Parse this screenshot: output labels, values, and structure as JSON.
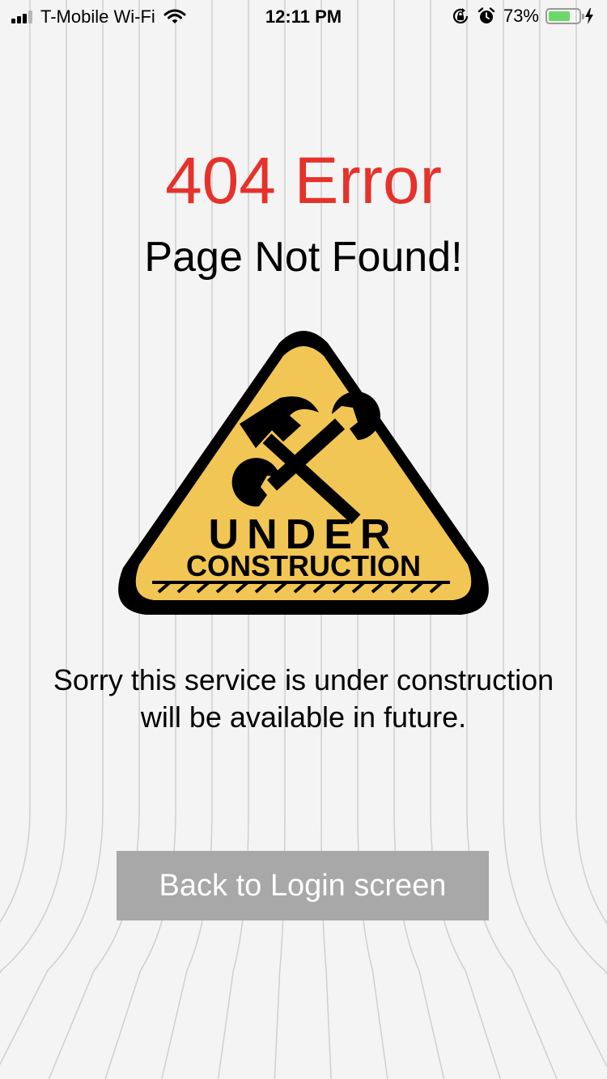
{
  "status_bar": {
    "carrier": "T-Mobile Wi-Fi",
    "time": "12:11 PM",
    "battery_percent_label": "73%",
    "battery_level": 0.73,
    "signal_bars_filled": 3,
    "signal_bars_total": 4,
    "icons": [
      "signal-icon",
      "wifi-icon",
      "orientation-lock-icon",
      "alarm-icon",
      "battery-icon",
      "charging-bolt-icon"
    ]
  },
  "error": {
    "code_title": "404 Error",
    "subtitle": "Page Not Found!",
    "message_line1": "Sorry this service is under construction",
    "message_line2": "will be available in future."
  },
  "sign": {
    "line1": "UNDER",
    "line2": "CONSTRUCTION",
    "icon": "hammer-wrench-icon"
  },
  "actions": {
    "back_label": "Back to Login screen"
  },
  "colors": {
    "error_red": "#e5322a",
    "sign_yellow": "#f2c654",
    "button_gray": "#a8a8a8",
    "battery_green": "#6dd86a"
  }
}
